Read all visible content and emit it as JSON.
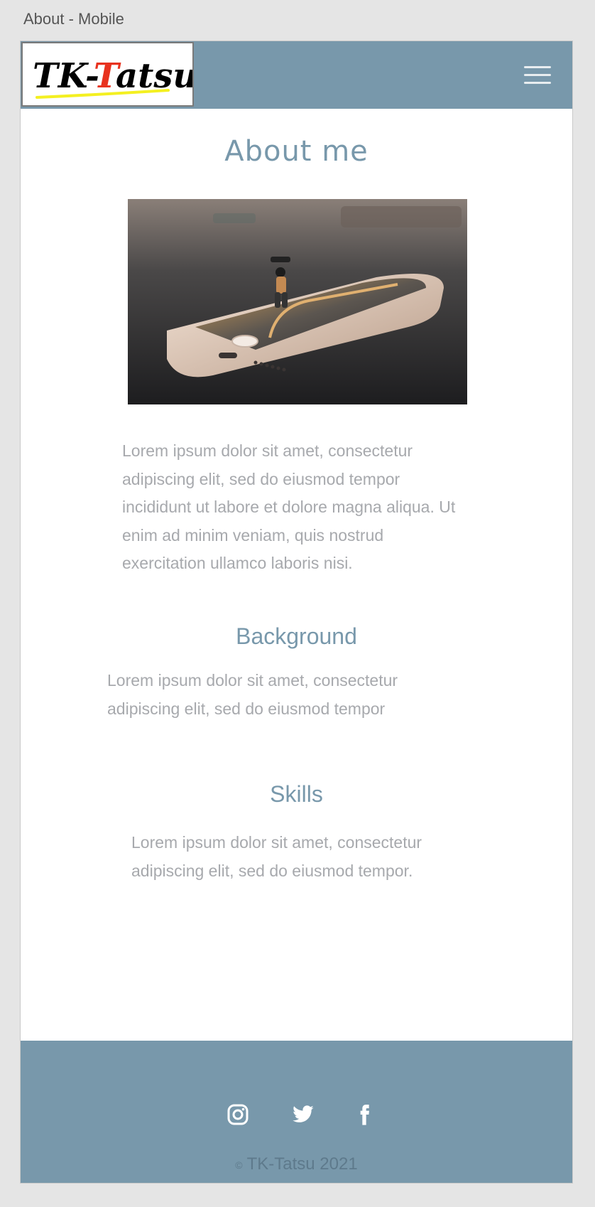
{
  "artboard": {
    "label": "About - Mobile"
  },
  "header": {
    "logo_text_black_1": "TK-",
    "logo_text_red": "T",
    "logo_text_black_2": "atsu",
    "menu_icon": "hamburger-menu-icon"
  },
  "main": {
    "title": "About me",
    "hero_image": "smartphone-skateboarder-photo",
    "intro": "Lorem ipsum dolor sit amet, consectetur adipiscing elit, sed do eiusmod tempor incididunt ut labore et dolore magna aliqua. Ut enim ad minim veniam, quis nostrud exercitation ullamco laboris nisi.",
    "sections": [
      {
        "title": "Background",
        "text": "Lorem ipsum dolor sit amet, consectetur adipiscing elit, sed do eiusmod tempor"
      },
      {
        "title": "Skills",
        "text": "Lorem ipsum dolor sit amet, consectetur adipiscing elit, sed do eiusmod tempor."
      }
    ]
  },
  "footer": {
    "social": [
      "instagram-icon",
      "twitter-icon",
      "facebook-icon"
    ],
    "copyright_symbol": "©",
    "copyright_text": "TK-Tatsu 2021"
  },
  "colors": {
    "brand": "#7898ab",
    "text_muted": "#a7a9ad",
    "logo_red": "#e8321e",
    "logo_underline": "#f4f021"
  }
}
